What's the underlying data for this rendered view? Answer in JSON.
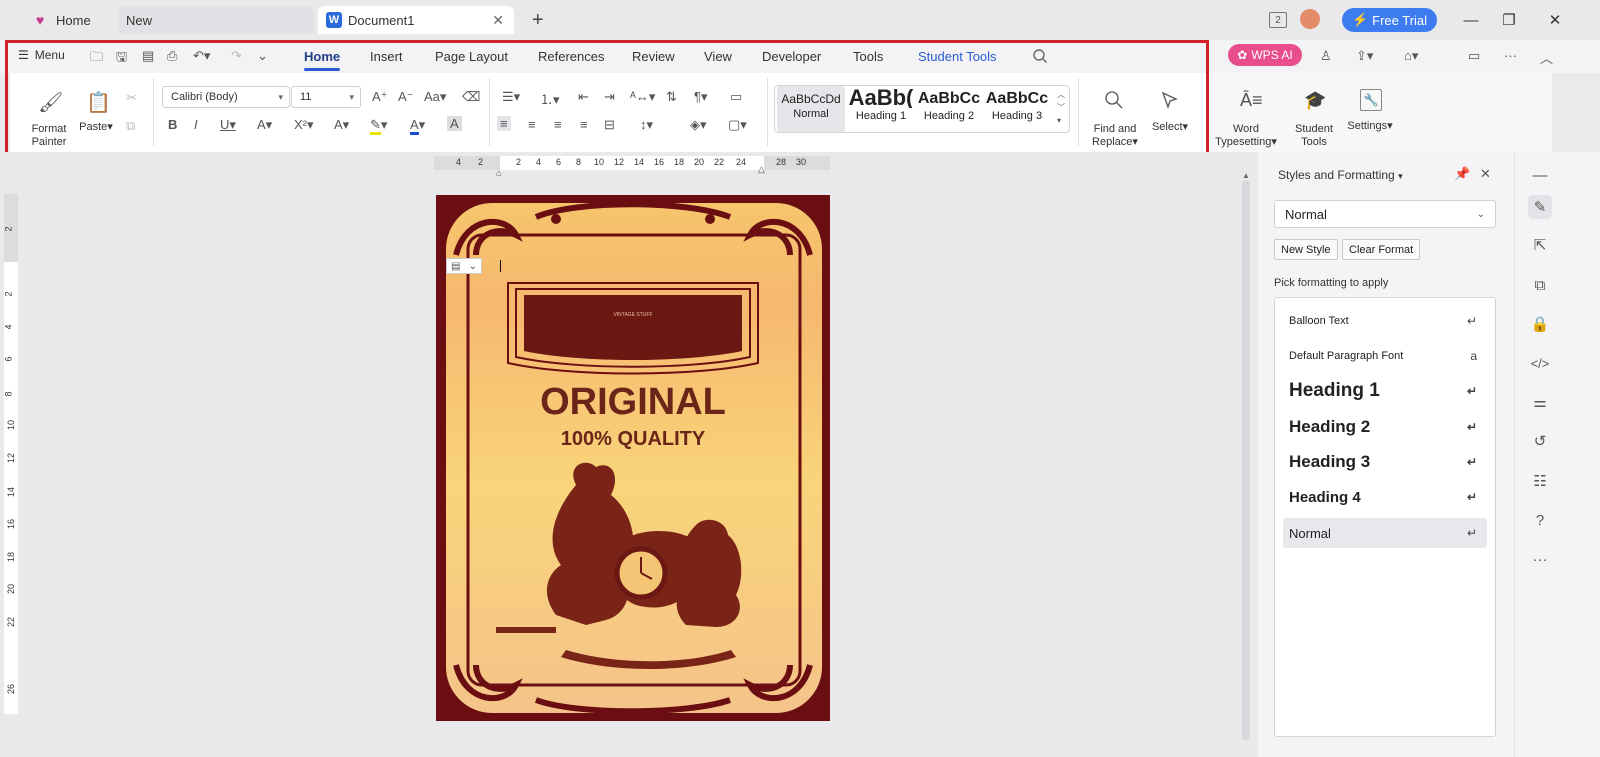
{
  "tabs": {
    "home": "Home",
    "new": "New",
    "document": "Document1"
  },
  "topbar": {
    "free_trial": "Free Trial",
    "page_count_badge": "2"
  },
  "menu": {
    "menu_label": "Menu",
    "tabs": [
      "Home",
      "Insert",
      "Page Layout",
      "References",
      "Review",
      "View",
      "Developer",
      "Tools",
      "Student Tools"
    ],
    "wps_ai": "WPS AI"
  },
  "ribbon": {
    "format_painter": "Format Painter",
    "format_painter_line1": "Format",
    "format_painter_line2": "Painter",
    "paste": "Paste",
    "font_name": "Calibri (Body)",
    "font_size": "11",
    "styles": [
      {
        "preview": "AaBbCcDd",
        "name": "Normal"
      },
      {
        "preview": "AaBb(",
        "name": "Heading 1"
      },
      {
        "preview": "AaBbCc",
        "name": "Heading 2"
      },
      {
        "preview": "AaBbCc",
        "name": "Heading 3"
      }
    ],
    "find_replace_line1": "Find and",
    "find_replace_line2": "Replace",
    "select": "Select",
    "word_typesetting_line1": "Word",
    "word_typesetting_line2": "Typesetting",
    "student_tools_line1": "Student",
    "student_tools_line2": "Tools",
    "settings": "Settings"
  },
  "ruler": {
    "horizontal": [
      "4",
      "2",
      "2",
      "4",
      "6",
      "8",
      "10",
      "12",
      "14",
      "16",
      "18",
      "20",
      "22",
      "24",
      "28",
      "30"
    ],
    "vertical": [
      "2",
      "2",
      "4",
      "6",
      "8",
      "10",
      "12",
      "14",
      "16",
      "18",
      "20",
      "22",
      "26"
    ]
  },
  "document": {
    "small_banner_text": "VINTAGE STUFF",
    "title": "ORIGINAL",
    "subtitle": "100% QUALITY",
    "colors": {
      "frame": "#6b0e12",
      "card_top": "#f6c26e",
      "card_bottom": "#f7c98a",
      "ink": "#6b2418"
    }
  },
  "styles_panel": {
    "title": "Styles and Formatting",
    "current_style": "Normal",
    "new_style": "New Style",
    "clear_format": "Clear Format",
    "pick_label": "Pick formatting to apply",
    "items": [
      {
        "label": "Balloon Text"
      },
      {
        "label": "Default Paragraph Font"
      },
      {
        "label": "Heading 1"
      },
      {
        "label": "Heading 2"
      },
      {
        "label": "Heading 3"
      },
      {
        "label": "Heading 4"
      },
      {
        "label": "Normal"
      }
    ]
  },
  "sidebar_icons": [
    "pen-icon",
    "cursor-select-icon",
    "crop-copy-icon",
    "lock-icon",
    "code-icon",
    "sliders-icon",
    "history-icon",
    "tree-structure-icon",
    "help-icon",
    "more-icon"
  ]
}
